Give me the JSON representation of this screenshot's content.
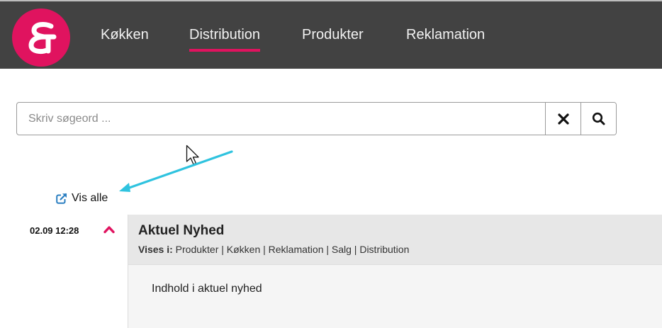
{
  "colors": {
    "brand": "#e0135f",
    "navbar": "#424242",
    "annotation_arrow": "#2fc3df"
  },
  "nav": {
    "items": [
      {
        "label": "Køkken",
        "active": false
      },
      {
        "label": "Distribution",
        "active": true
      },
      {
        "label": "Produkter",
        "active": false
      },
      {
        "label": "Reklamation",
        "active": false
      }
    ]
  },
  "search": {
    "placeholder": "Skriv søgeord ...",
    "value": ""
  },
  "icons": [
    "logo-ampersand-icon",
    "clear-x-icon",
    "search-icon",
    "external-link-icon",
    "chevron-up-icon",
    "mouse-pointer-icon"
  ],
  "vis_alle": {
    "label": "Vis alle"
  },
  "news": [
    {
      "date": "02.09 12:28",
      "title": "Aktuel Nyhed",
      "shown_in_label": "Vises i:",
      "shown_in_values": "Produkter | Køkken | Reklamation | Salg | Distribution",
      "body": "Indhold i aktuel nyhed"
    }
  ]
}
